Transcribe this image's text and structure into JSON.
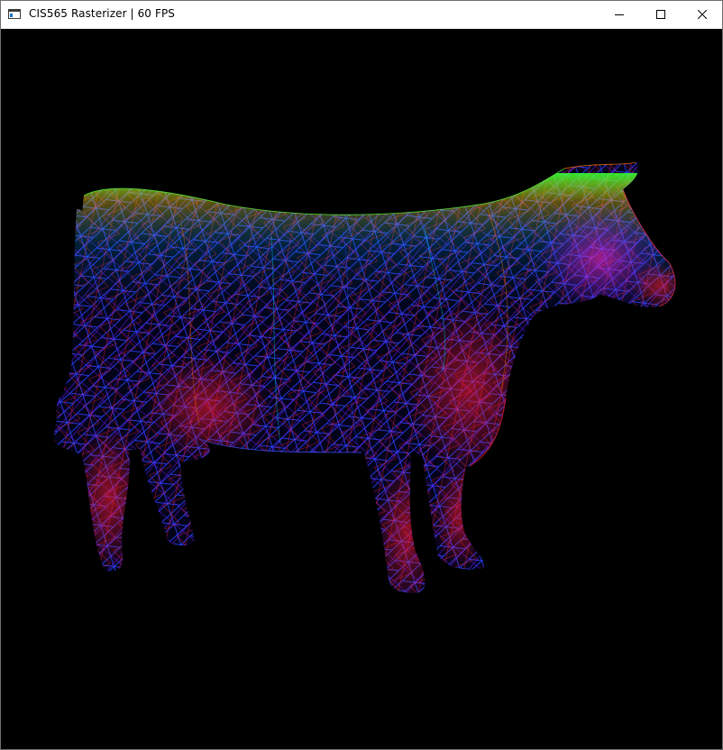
{
  "window": {
    "title": "CIS565 Rasterizer | 60 FPS",
    "app_icon": "console-app-icon",
    "controls": {
      "minimize_icon": "minimize-icon",
      "maximize_icon": "maximize-icon",
      "close_icon": "close-icon"
    }
  },
  "viewport": {
    "background": "#000000",
    "content": "wireframe-cow-mesh",
    "palette": [
      "#ff0033",
      "#ff7a00",
      "#ffe000",
      "#33ff33",
      "#00c8ff",
      "#2040ff",
      "#7a18ff",
      "#ff20c0"
    ]
  }
}
